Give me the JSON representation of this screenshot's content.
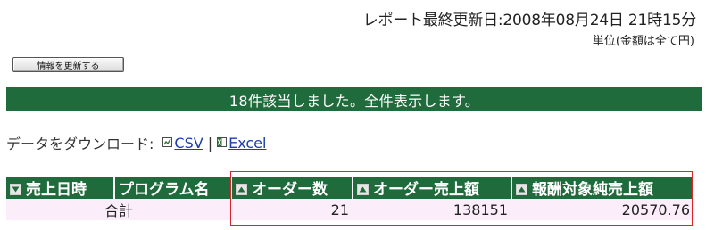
{
  "header": {
    "report_updated": "レポート最終更新日:2008年08月24日 21時15分",
    "unit_note": "単位(金額は全て円)"
  },
  "toolbar": {
    "refresh_label": "情報を更新する"
  },
  "banner": {
    "result_text": "18件該当しました。全件表示します。"
  },
  "download": {
    "label": "データをダウンロード:",
    "csv_label": "CSV",
    "separator": "|",
    "excel_label": "Excel"
  },
  "table": {
    "columns": [
      {
        "label": "売上日時",
        "sort_icon": "sort-down-icon"
      },
      {
        "label": "プログラム名",
        "sort_icon": null
      },
      {
        "label": "オーダー数",
        "sort_icon": "sort-up-icon"
      },
      {
        "label": "オーダー売上額",
        "sort_icon": "sort-up-icon"
      },
      {
        "label": "報酬対象純売上額",
        "sort_icon": "sort-up-icon"
      }
    ],
    "total_row": {
      "label": "合計",
      "order_count": "21",
      "order_sales": "138151",
      "net_sales": "20570.76"
    }
  },
  "colors": {
    "header_green": "#1f6b3c",
    "row_pink": "#fbeefa",
    "highlight_red": "#d9262a",
    "link_blue": "#1b3ea8"
  }
}
